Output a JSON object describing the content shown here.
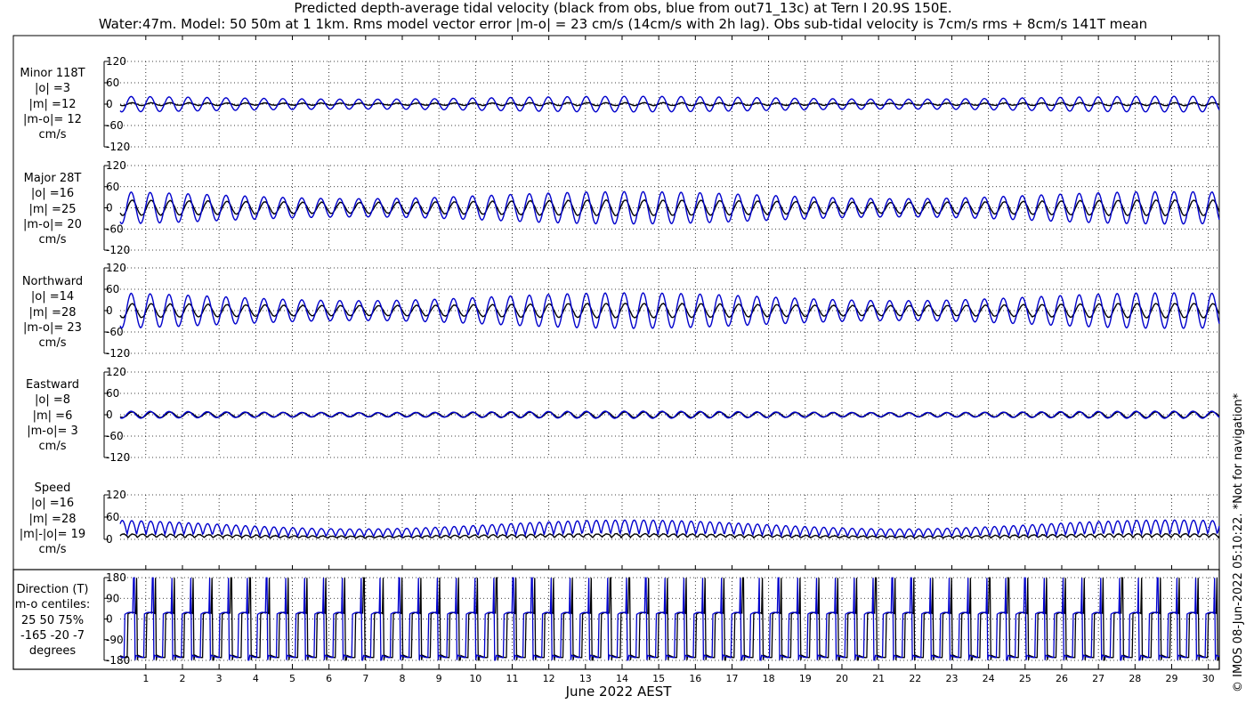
{
  "header": {
    "title_line1": "Predicted depth-average tidal velocity (black from obs, blue from out71_13c) at Tern I 20.9S 150E.",
    "title_line2": "Water:47m. Model: 50 50m at 1 1km. Rms model vector error |m-o| = 23 cm/s (14cm/s with 2h lag). Obs sub-tidal velocity is 7cm/s rms + 8cm/s 141T mean"
  },
  "panels": [
    {
      "lines": [
        "Minor 118T",
        "|o| =3",
        "|m| =12",
        "|m-o|= 12",
        "cm/s"
      ]
    },
    {
      "lines": [
        "Major 28T",
        "|o| =16",
        "|m| =25",
        "|m-o|= 20",
        "cm/s"
      ]
    },
    {
      "lines": [
        "Northward",
        "|o| =14",
        "|m| =28",
        "|m-o|= 23",
        "cm/s"
      ]
    },
    {
      "lines": [
        "Eastward",
        "|o| =8",
        "|m| =6",
        "|m-o|= 3",
        "cm/s"
      ]
    },
    {
      "lines": [
        "Speed",
        "|o| =16",
        "|m| =28",
        "|m|-|o|= 19",
        "cm/s"
      ]
    },
    {
      "lines": [
        "Direction (T)",
        "m-o centiles:",
        "25  50  75%",
        "-165  -20   -7",
        "degrees"
      ]
    }
  ],
  "footer": {
    "copyright": "© IMOS 08-Jun-2022 05:10:22. *Not for navigation*",
    "xlabel": "June 2022 AEST"
  },
  "chart_data": {
    "type": "line",
    "x_label": "June 2022 AEST",
    "x_ticks": [
      "1",
      "2",
      "3",
      "4",
      "5",
      "6",
      "7",
      "8",
      "9",
      "10",
      "11",
      "12",
      "13",
      "14",
      "15",
      "16",
      "17",
      "18",
      "19",
      "20",
      "21",
      "22",
      "23",
      "24",
      "25",
      "26",
      "27",
      "28",
      "29",
      "30"
    ],
    "x_range": [
      0.3,
      30.3
    ],
    "series_colors": {
      "obs": "#000000",
      "model": "#0000cc"
    },
    "series": [
      "black from obs",
      "blue from out71_13c"
    ],
    "grid": "dotted",
    "panels": [
      {
        "name": "Minor 118T",
        "ylim": [
          -120,
          120
        ],
        "yticks": [
          "120",
          "60",
          "0",
          "-60",
          "-120"
        ],
        "obs_amp": 4,
        "model_amp": [
          14,
          22
        ]
      },
      {
        "name": "Major 28T",
        "ylim": [
          -120,
          120
        ],
        "yticks": [
          "120",
          "60",
          "0",
          "-60",
          "-120"
        ],
        "obs_amp": 22,
        "model_amp": [
          26,
          46
        ]
      },
      {
        "name": "Northward",
        "ylim": [
          -120,
          120
        ],
        "yticks": [
          "120",
          "60",
          "0",
          "-60",
          "-120"
        ],
        "obs_amp": 20,
        "model_amp": [
          28,
          50
        ]
      },
      {
        "name": "Eastward",
        "ylim": [
          -120,
          120
        ],
        "yticks": [
          "120",
          "60",
          "0",
          "-60",
          "-120"
        ],
        "obs_amp": 8,
        "model_amp": [
          6,
          10
        ]
      },
      {
        "name": "Speed",
        "ylim": [
          0,
          120
        ],
        "yticks": [
          "120",
          "60",
          "0"
        ],
        "obs_amp": 14,
        "model_amp": [
          28,
          52
        ]
      },
      {
        "name": "Direction (T)",
        "ylim": [
          -180,
          180
        ],
        "yticks": [
          "180",
          "90",
          "0",
          "-90",
          "-180"
        ],
        "direction": true
      }
    ]
  }
}
